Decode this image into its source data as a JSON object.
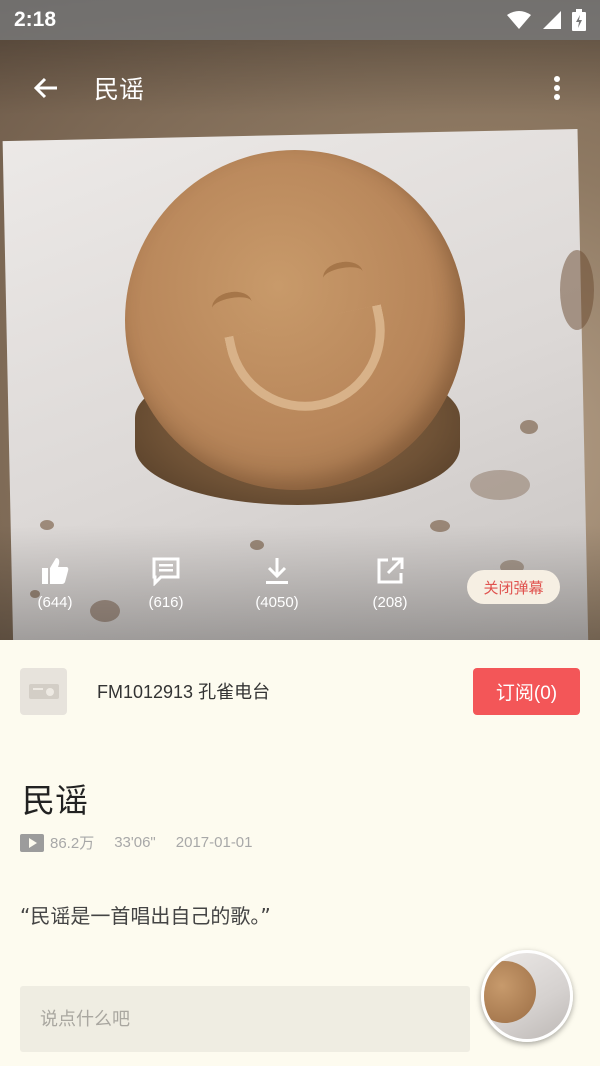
{
  "status_bar": {
    "time": "2:18"
  },
  "toolbar": {
    "title": "民谣"
  },
  "actions": [
    {
      "name": "like",
      "icon": "thumb-up-icon",
      "count": "(644)"
    },
    {
      "name": "comment",
      "icon": "comment-icon",
      "count": "(616)"
    },
    {
      "name": "download",
      "icon": "download-icon",
      "count": "(4050)"
    },
    {
      "name": "share",
      "icon": "share-icon",
      "count": "(208)"
    }
  ],
  "danmaku_toggle": "关闭弹幕",
  "channel": {
    "name": "FM1012913  孔雀电台",
    "subscribe_label": "订阅(0)"
  },
  "episode": {
    "title": "民谣",
    "plays": "86.2万",
    "duration": "33'06\"",
    "date": "2017-01-01",
    "quote": "“民谣是一首唱出自己的歌。”"
  },
  "comment": {
    "placeholder": "说点什么吧"
  },
  "colors": {
    "accent": "#f35658",
    "background": "#fdfbef",
    "danmaku_text": "#e0534f"
  }
}
